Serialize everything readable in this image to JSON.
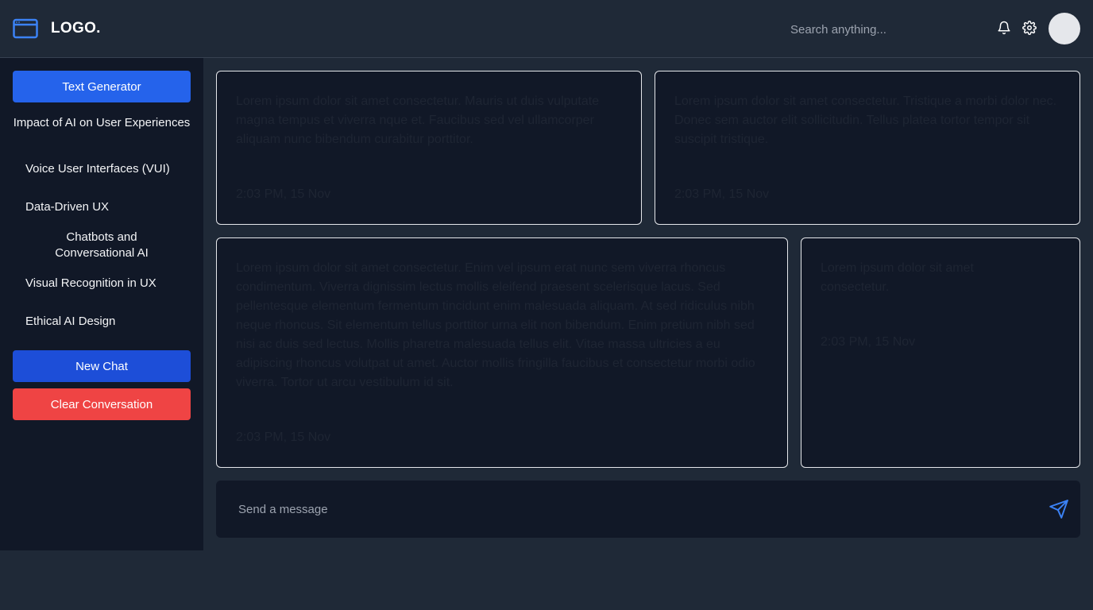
{
  "header": {
    "logo_icon": "browser-window-icon",
    "logo_text": "LOGO.",
    "search_placeholder": "Search anything...",
    "icons": [
      "bell-icon",
      "gear-icon"
    ],
    "accent": "#3b82f6"
  },
  "sidebar": {
    "primary_button": "Text Generator",
    "items": [
      {
        "label": "Impact of AI on User Experiences"
      },
      {
        "label": "Voice User Interfaces (VUI)"
      },
      {
        "label": "Data-Driven UX"
      },
      {
        "label": "Chatbots and Conversational AI"
      },
      {
        "label": "Visual Recognition in UX"
      },
      {
        "label": "Ethical AI Design"
      }
    ],
    "new_chat": "New Chat",
    "clear": "Clear Conversation"
  },
  "messages": [
    {
      "text": "Lorem ipsum dolor sit amet consectetur. Mauris ut duis vulputate magna tempus et viverra nque et. Faucibus sed vel ullamcorper aliquam nunc bibendum curabitur porttitor.",
      "time": "2:03 PM, 15 Nov"
    },
    {
      "text": "Lorem ipsum dolor sit amet consectetur. Tristique a morbi dolor nec. Donec sem auctor elit sollicitudin. Tellus platea tortor tempor sit suscipit tristique.",
      "time": "2:03 PM, 15 Nov"
    },
    {
      "text": "Lorem ipsum dolor sit amet consectetur. Enim vel ipsum erat nunc sem viverra rhoncus condimentum. Viverra dignissim lectus mollis eleifend praesent scelerisque lacus. Sed pellentesque elementum fermentum tincidunt enim malesuada aliquam. At sed ridiculus nibh neque rhoncus. Sit elementum tellus porttitor urna elit non bibendum. Enim pretium nibh sed nisi ac duis sed lectus. Mollis pharetra malesuada tellus elit. Vitae massa ultricies a eu adipiscing rhoncus volutpat ut amet. Auctor mollis fringilla faucibus et consectetur morbi odio viverra. Tortor ut arcu vestibulum id sit.",
      "time": "2:03 PM, 15 Nov"
    },
    {
      "text": "Lorem ipsum dolor sit amet consectetur.",
      "time": "2:03 PM, 15 Nov"
    }
  ],
  "composer": {
    "placeholder": "Send a message",
    "send_icon": "send-icon"
  }
}
